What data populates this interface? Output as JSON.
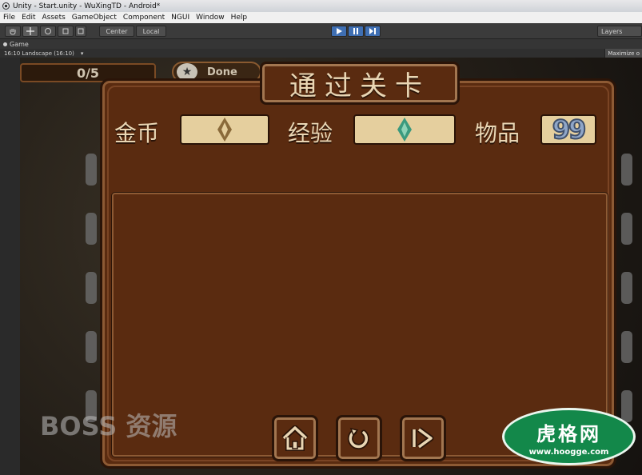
{
  "window": {
    "title": "Unity - Start.unity - WuXingTD - Android*"
  },
  "menu": {
    "items": [
      "File",
      "Edit",
      "Assets",
      "GameObject",
      "Component",
      "NGUI",
      "Window",
      "Help"
    ]
  },
  "toolbar": {
    "pivot_label": "Center",
    "space_label": "Local",
    "layers_label": "Layers",
    "tools": [
      "hand-tool",
      "move-tool",
      "rotate-tool",
      "scale-tool",
      "rect-tool"
    ],
    "playback": [
      "play",
      "pause",
      "step"
    ]
  },
  "game_tab": {
    "label": "Game",
    "aspect": "16:10 Landscape (16:10)",
    "maximize": "Maximize o"
  },
  "hud": {
    "wave": "0/5",
    "done_label": "Done"
  },
  "dialog": {
    "title": "通过关卡",
    "gold_label": "金币",
    "exp_label": "经验",
    "items_label": "物品",
    "items_count": "99",
    "gold_gem_color": "#8a6a3a",
    "exp_gem_color": "#3b9a7e",
    "buttons": [
      "home",
      "replay",
      "next"
    ]
  },
  "watermarks": {
    "boss": "BOSS 资源",
    "hoogge_title": "虎格网",
    "hoogge_url": "www.hoogge.com"
  }
}
